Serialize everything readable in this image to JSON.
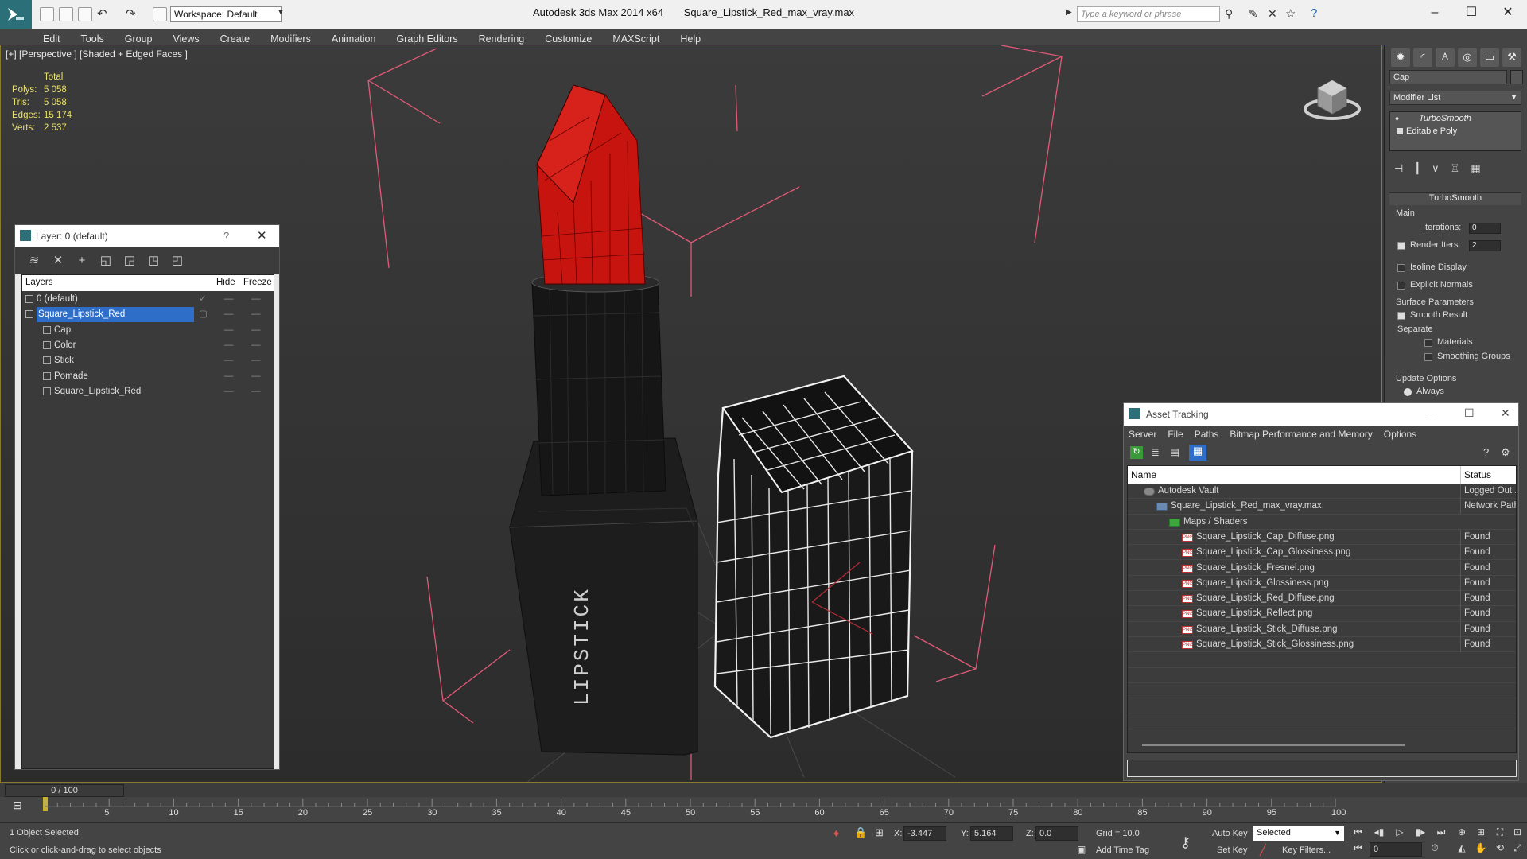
{
  "titlebar": {
    "app_name": "Autodesk 3ds Max  2014 x64",
    "file_name": "Square_Lipstick_Red_max_vray.max",
    "workspace": "Workspace: Default",
    "search_placeholder": "Type a keyword or phrase"
  },
  "menu": [
    "Edit",
    "Tools",
    "Group",
    "Views",
    "Create",
    "Modifiers",
    "Animation",
    "Graph Editors",
    "Rendering",
    "Customize",
    "MAXScript",
    "Help"
  ],
  "viewport": {
    "label": "[+] [Perspective ] [Shaded + Edged Faces ]",
    "stats_title": "Total",
    "stats": [
      {
        "label": "Polys:",
        "value": "5 058"
      },
      {
        "label": "Tris:",
        "value": "5 058"
      },
      {
        "label": "Edges:",
        "value": "15 174"
      },
      {
        "label": "Verts:",
        "value": "2 537"
      }
    ],
    "product_text": "LIPSTICK"
  },
  "layer_dialog": {
    "title": "Layer: 0 (default)",
    "help": "?",
    "columns": {
      "layers": "Layers",
      "hide": "Hide",
      "freeze": "Freeze"
    },
    "rows": [
      {
        "name": "0 (default)",
        "indent": 0,
        "selected": false
      },
      {
        "name": "Square_Lipstick_Red",
        "indent": 0,
        "selected": true
      },
      {
        "name": "Cap",
        "indent": 1,
        "selected": false
      },
      {
        "name": "Color",
        "indent": 1,
        "selected": false
      },
      {
        "name": "Stick",
        "indent": 1,
        "selected": false
      },
      {
        "name": "Pomade",
        "indent": 1,
        "selected": false
      },
      {
        "name": "Square_Lipstick_Red",
        "indent": 1,
        "selected": false
      }
    ],
    "dash": "—"
  },
  "command_panel": {
    "object_name": "Cap",
    "modifier_list": "Modifier List",
    "stack": [
      "TurboSmooth",
      "Editable Poly"
    ],
    "rollout": "TurboSmooth",
    "main": "Main",
    "iterations_label": "Iterations:",
    "iterations_value": "0",
    "render_iters_label": "Render Iters:",
    "render_iters_value": "2",
    "isoline": "Isoline Display",
    "explicit_normals": "Explicit Normals",
    "surface_params": "Surface Parameters",
    "smooth_result": "Smooth Result",
    "separate": "Separate",
    "materials": "Materials",
    "smoothing_groups": "Smoothing Groups",
    "update_options": "Update Options",
    "always": "Always"
  },
  "asset_tracking": {
    "title": "Asset Tracking",
    "menu": [
      "Server",
      "File",
      "Paths",
      "Bitmap Performance and Memory",
      "Options"
    ],
    "columns": {
      "name": "Name",
      "status": "Status"
    },
    "rows": [
      {
        "name": "Autodesk Vault",
        "status": "Logged Out ...",
        "indent": 1,
        "icon": "vault"
      },
      {
        "name": "Square_Lipstick_Red_max_vray.max",
        "status": "Network Path",
        "indent": 2,
        "icon": "max"
      },
      {
        "name": "Maps / Shaders",
        "status": "",
        "indent": 3,
        "icon": "folder"
      },
      {
        "name": "Square_Lipstick_Cap_Diffuse.png",
        "status": "Found",
        "indent": 4,
        "icon": "png"
      },
      {
        "name": "Square_Lipstick_Cap_Glossiness.png",
        "status": "Found",
        "indent": 4,
        "icon": "png"
      },
      {
        "name": "Square_Lipstick_Fresnel.png",
        "status": "Found",
        "indent": 4,
        "icon": "png"
      },
      {
        "name": "Square_Lipstick_Glossiness.png",
        "status": "Found",
        "indent": 4,
        "icon": "png"
      },
      {
        "name": "Square_Lipstick_Red_Diffuse.png",
        "status": "Found",
        "indent": 4,
        "icon": "png"
      },
      {
        "name": "Square_Lipstick_Reflect.png",
        "status": "Found",
        "indent": 4,
        "icon": "png"
      },
      {
        "name": "Square_Lipstick_Stick_Diffuse.png",
        "status": "Found",
        "indent": 4,
        "icon": "png"
      },
      {
        "name": "Square_Lipstick_Stick_Glossiness.png",
        "status": "Found",
        "indent": 4,
        "icon": "png"
      }
    ]
  },
  "timeline": {
    "frame": "0 / 100",
    "ticks": [
      "5",
      "10",
      "15",
      "20",
      "25",
      "30",
      "35",
      "40",
      "45",
      "50",
      "55",
      "60",
      "65",
      "70",
      "75",
      "80",
      "85",
      "90",
      "95",
      "100"
    ]
  },
  "status_bar": {
    "selection": "1 Object Selected",
    "prompt": "Click or click-and-drag to select objects",
    "x_label": "X:",
    "x_value": "-3.447",
    "y_label": "Y:",
    "y_value": "5.164",
    "z_label": "Z:",
    "z_value": "0.0",
    "grid": "Grid = 10.0",
    "add_time_tag": "Add Time Tag",
    "auto_key": "Auto Key",
    "set_key": "Set Key",
    "key_mode": "Selected",
    "key_filters": "Key Filters...",
    "frame_value": "0"
  },
  "colors": {
    "accent": "#2b6f78",
    "lipstick_red": "#c8140e",
    "selection": "#2f6ec8",
    "stats_yellow": "#e8e070"
  }
}
